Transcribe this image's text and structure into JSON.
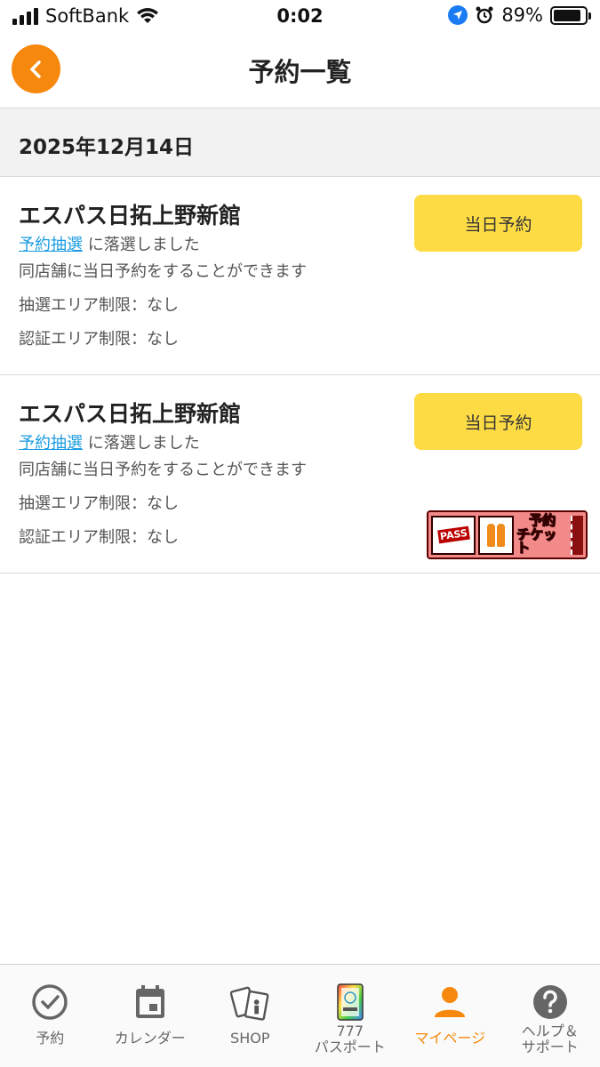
{
  "status_bar": {
    "carrier": "SoftBank",
    "time": "0:02",
    "battery_percent": "89%",
    "battery_level": 0.89
  },
  "nav": {
    "title": "予約一覧"
  },
  "date_header": "2025年12月14日",
  "reservations": [
    {
      "store_name": "エスパス日拓上野新館",
      "lottery_link": "予約抽選",
      "result_text": " に落選しました",
      "note": "同店舗に当日予約をすることができます",
      "lottery_area": "抽選エリア制限：なし",
      "auth_area": "認証エリア制限：なし",
      "button_label": "当日予約"
    },
    {
      "store_name": "エスパス日拓上野新館",
      "lottery_link": "予約抽選",
      "result_text": " に落選しました",
      "note": "同店舗に当日予約をすることができます",
      "lottery_area": "抽選エリア制限：なし",
      "auth_area": "認証エリア制限：なし",
      "button_label": "当日予約",
      "ticket_badge": {
        "pass_text": "PASS",
        "line1": "予約",
        "line2": "チケット"
      }
    }
  ],
  "tabs": [
    {
      "label": "予約",
      "icon": "check-circle-icon",
      "active": false
    },
    {
      "label": "カレンダー",
      "icon": "calendar-icon",
      "active": false
    },
    {
      "label": "SHOP",
      "icon": "shop-cards-icon",
      "active": false
    },
    {
      "label": "777\nパスポート",
      "line1": "777",
      "line2": "パスポート",
      "icon": "passport-icon",
      "active": false
    },
    {
      "label": "マイページ",
      "icon": "person-icon",
      "active": true
    },
    {
      "label": "ヘルプ＆\nサポート",
      "line1": "ヘルプ＆",
      "line2": "サポート",
      "icon": "help-icon",
      "active": false
    }
  ],
  "colors": {
    "accent": "#f7880e",
    "button_yellow": "#fddb45",
    "link_blue": "#1a9be0"
  }
}
